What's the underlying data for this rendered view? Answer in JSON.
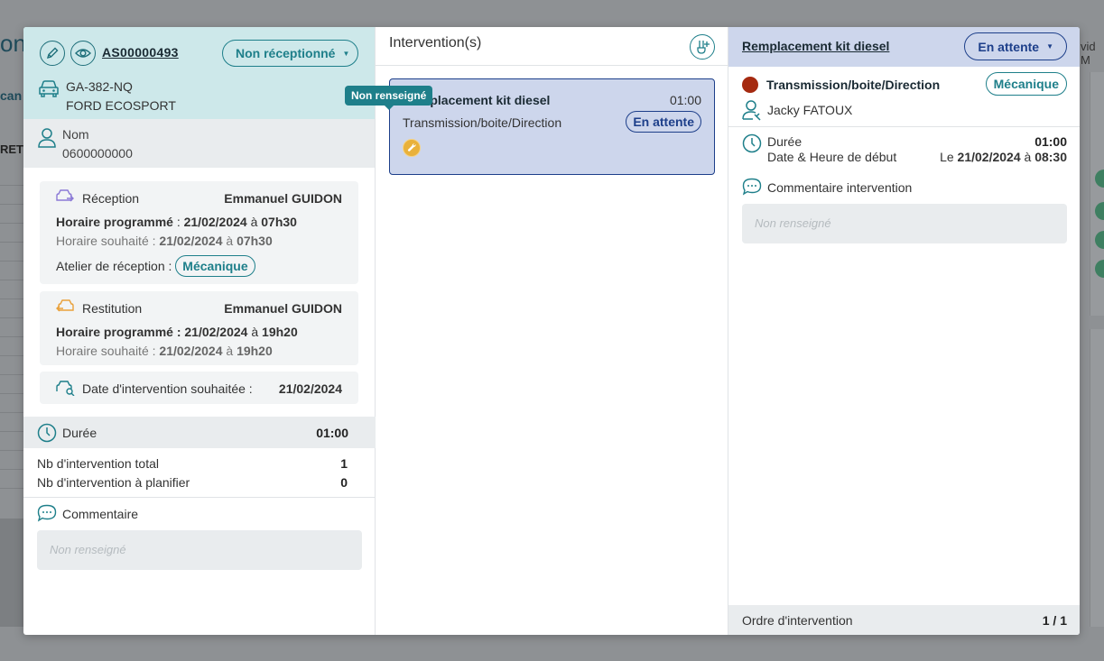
{
  "header": {
    "reference": "AS00000493",
    "status": "Non réceptionné",
    "plate": "GA-382-NQ",
    "model": "FORD ECOSPORT"
  },
  "client": {
    "name": "Nom",
    "phone": "0600000000"
  },
  "reception": {
    "label": "Réception",
    "person": "Emmanuel GUIDON",
    "scheduled_label": "Horaire programmé",
    "scheduled_date": "21/02/2024",
    "scheduled_time": "07h30",
    "wished_label": "Horaire souhaité",
    "wished_date": "21/02/2024",
    "wished_time": "07h30",
    "workshop_label": "Atelier de réception :",
    "workshop": "Mécanique"
  },
  "restitution": {
    "label": "Restitution",
    "person": "Emmanuel GUIDON",
    "scheduled_label": "Horaire programmé :",
    "scheduled_date": "21/02/2024",
    "scheduled_time": "19h20",
    "wished_label": "Horaire souhaité",
    "wished_date": "21/02/2024",
    "wished_time": "19h20"
  },
  "wished_intervention": {
    "label": "Date d'intervention souhaitée :",
    "date": "21/02/2024"
  },
  "summary": {
    "duration_label": "Durée",
    "duration": "01:00",
    "total_label": "Nb d'intervention total",
    "total": "1",
    "to_plan_label": "Nb d'intervention à planifier",
    "to_plan": "0",
    "comment_label": "Commentaire",
    "comment_placeholder": "Non renseigné"
  },
  "interventions": {
    "title": "Intervention(s)",
    "card": {
      "title": "Remplacement kit diesel",
      "time": "01:00",
      "category": "Transmission/boite/Direction",
      "status": "En attente",
      "tooltip": "Non renseigné"
    }
  },
  "detail": {
    "title": "Remplacement kit diesel",
    "status": "En attente",
    "category": "Transmission/boite/Direction",
    "workshop": "Mécanique",
    "technician": "Jacky FATOUX",
    "duration_label": "Durée",
    "duration": "01:00",
    "start_label": "Date & Heure de début",
    "start_prefix": "Le",
    "start_date": "21/02/2024",
    "start_sep": "à",
    "start_time": "08:30",
    "comment_label": "Commentaire intervention",
    "comment_placeholder": "Non renseigné",
    "order_label": "Ordre d'intervention",
    "order": "1 / 1"
  },
  "background": {
    "left_title": "on",
    "left_tab": "can",
    "left_col": "RET",
    "right_text": "vid M"
  },
  "colors": {
    "teal": "#1e7f8a",
    "navy": "#1d3f8a",
    "header_teal_bg": "#cde8ea",
    "header_blue_bg": "#cdd6ec",
    "warning": "#e9b13b",
    "danger_dot": "#a52a10"
  }
}
